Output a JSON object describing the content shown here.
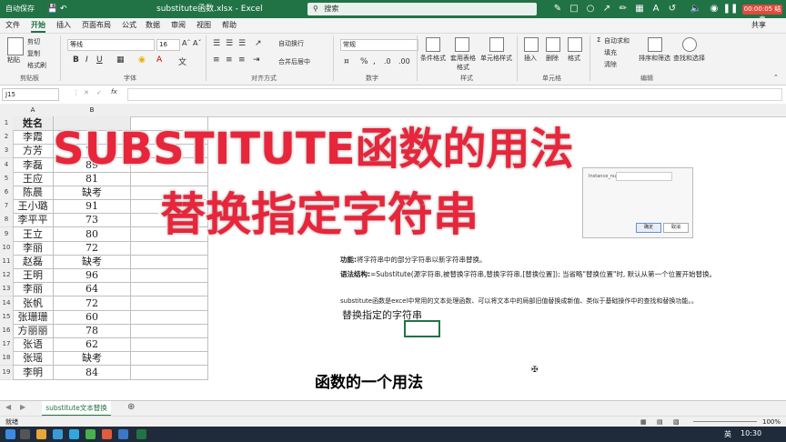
{
  "titlebar": {
    "autosave_label": "自动保存",
    "filename": "substitute函数.xlsx - Excel",
    "search_placeholder": "搜索",
    "recording": "00:00:05 结束"
  },
  "menu": {
    "tabs": [
      "文件",
      "开始",
      "插入",
      "页面布局",
      "公式",
      "数据",
      "审阅",
      "视图",
      "帮助"
    ],
    "active": "开始",
    "share": "共享"
  },
  "ribbon": {
    "paste": "粘贴",
    "cut": "剪切",
    "copy": "复制",
    "format_painter": "格式刷",
    "clipboard_group": "剪贴板",
    "font_name": "等线",
    "font_size": "16",
    "font_group": "字体",
    "wrap_text": "自动换行",
    "merge_center": "合并后居中",
    "alignment_group": "对齐方式",
    "number_format": "常规",
    "number_group": "数字",
    "cond_format": "条件格式",
    "table_format": "套用表格格式",
    "cell_styles": "单元格样式",
    "styles_group": "样式",
    "insert": "插入",
    "delete": "删除",
    "format": "格式",
    "cells_group": "单元格",
    "autosum": "自动求和",
    "fill": "填充",
    "clear": "清除",
    "sort_filter": "排序和筛选",
    "find_select": "查找和选择",
    "editing_group": "编辑"
  },
  "formula_bar": {
    "name_box": "J15",
    "formula": ""
  },
  "sheet": {
    "col_a_header": "A",
    "col_b_header": "B",
    "header_name": "姓名",
    "rows": [
      {
        "n": "2",
        "name": "李霞",
        "score": ""
      },
      {
        "n": "3",
        "name": "方芳",
        "score": "78"
      },
      {
        "n": "4",
        "name": "李磊",
        "score": "89"
      },
      {
        "n": "5",
        "name": "王应",
        "score": "81"
      },
      {
        "n": "6",
        "name": "陈晨",
        "score": "缺考"
      },
      {
        "n": "7",
        "name": "王小璐",
        "score": "91"
      },
      {
        "n": "8",
        "name": "李平平",
        "score": "73"
      },
      {
        "n": "9",
        "name": "王立",
        "score": "80"
      },
      {
        "n": "10",
        "name": "李丽",
        "score": "72"
      },
      {
        "n": "11",
        "name": "赵磊",
        "score": "缺考"
      },
      {
        "n": "12",
        "name": "王明",
        "score": "96"
      },
      {
        "n": "13",
        "name": "李丽",
        "score": "64"
      },
      {
        "n": "14",
        "name": "张帆",
        "score": "72"
      },
      {
        "n": "15",
        "name": "张珊珊",
        "score": "60"
      },
      {
        "n": "16",
        "name": "方丽丽",
        "score": "78"
      },
      {
        "n": "17",
        "name": "张语",
        "score": "62"
      },
      {
        "n": "18",
        "name": "张瑶",
        "score": "缺考"
      },
      {
        "n": "19",
        "name": "李明",
        "score": "84"
      }
    ],
    "row1": "1"
  },
  "overlay": {
    "title_line1": "SUBSTITUTE函数的用法",
    "title_line2": "替换指定字符串"
  },
  "notes": {
    "function_label": "功能:",
    "function_text": "将字符串中的部分字符串以新字符串替换。",
    "syntax_label": "语法结构:",
    "syntax_text": "=Substitute(源字符串,被替换字符串,替换字符串,[替换位置]); 当省略\"替换位置\"时, 默认从第一个位置开始替换。",
    "desc": "substitute函数是excel中常用的文本处理函数、可以将文本中的局部旧值替换成新值、类似于基础操作中的查找和替换功能。。",
    "subheading": "替换指定的字符串",
    "dialog_field": "Instance_num",
    "dialog_ok": "确定",
    "dialog_cancel": "取消"
  },
  "subtitle": "函数的一个用法",
  "sheet_tab": "substitute文本替换",
  "status": {
    "ready": "就绪",
    "zoom": "100%"
  },
  "taskbar": {
    "lang": "英",
    "time": "10:30"
  }
}
